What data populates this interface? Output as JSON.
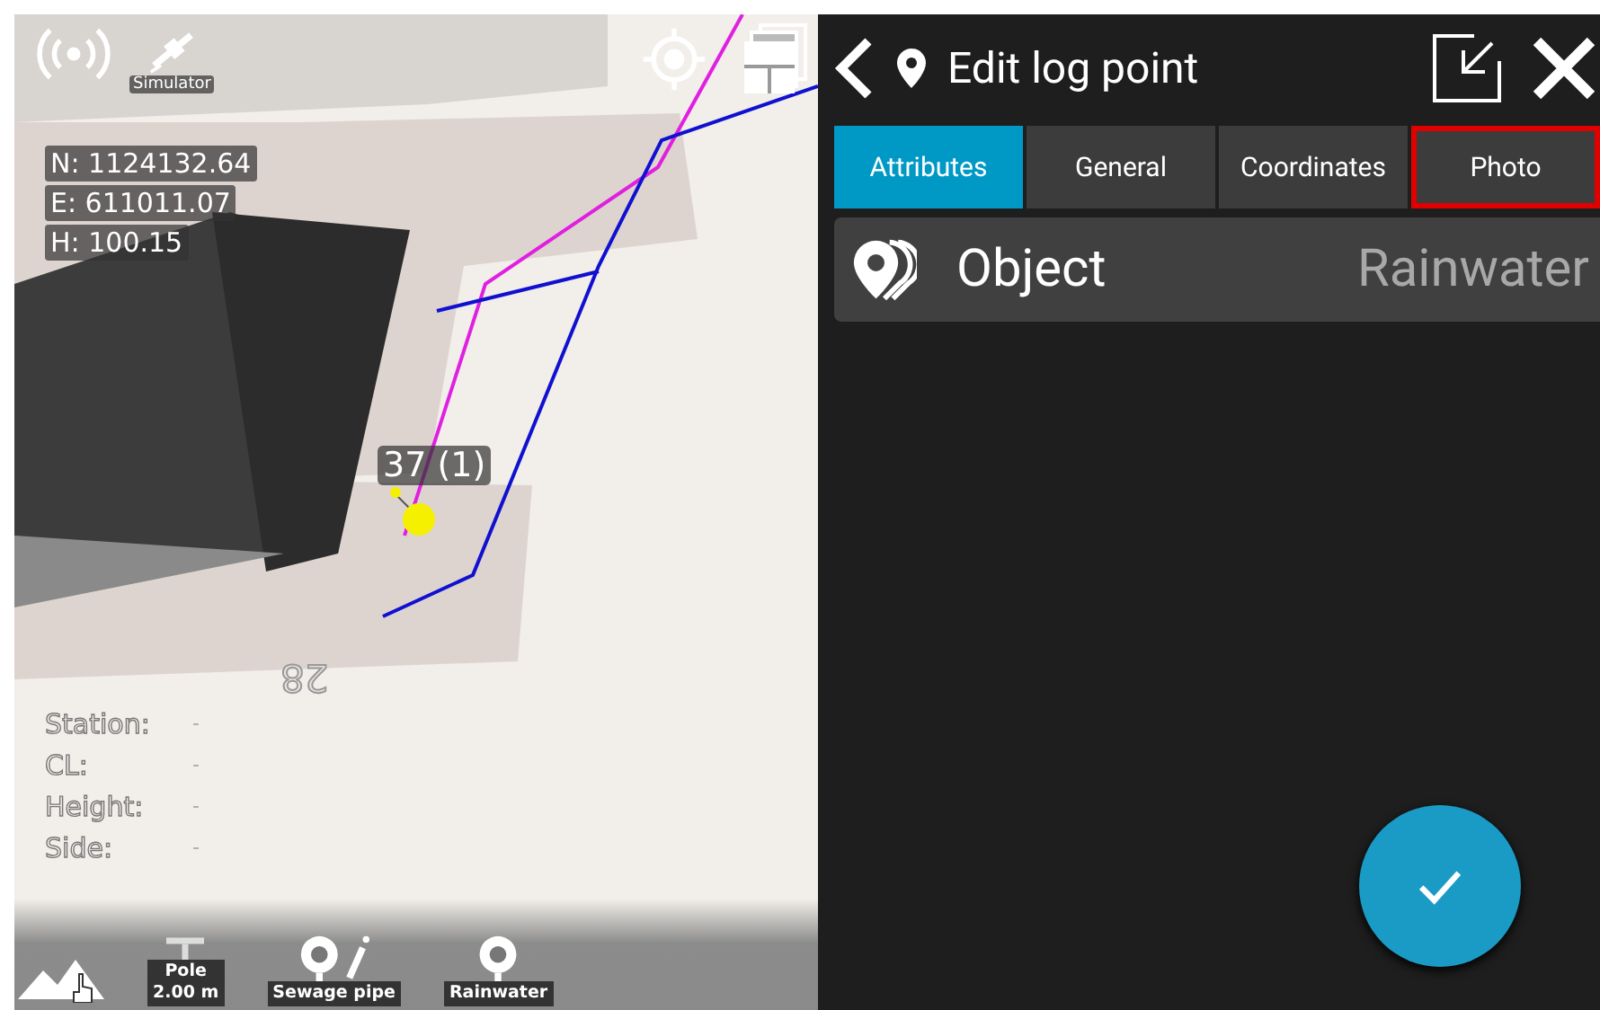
{
  "map": {
    "gps_label": "Simulator",
    "coordinates": [
      "N: 1124132.64",
      "E: 611011.07",
      "H: 100.15"
    ],
    "point_label": "37 (1)",
    "building_number": "28",
    "info": [
      {
        "label": "Station:",
        "value": "-"
      },
      {
        "label": "CL:",
        "value": "-"
      },
      {
        "label": "Height:",
        "value": "-"
      },
      {
        "label": "Side:",
        "value": "-"
      }
    ],
    "toolbar": [
      {
        "kind": "pole",
        "lines": [
          "Pole",
          "2.00 m"
        ]
      },
      {
        "kind": "pipe",
        "lines": [
          "Sewage pipe"
        ]
      },
      {
        "kind": "point",
        "lines": [
          "Rainwater"
        ]
      }
    ]
  },
  "panel": {
    "title": "Edit log point",
    "tabs": [
      {
        "label": "Attributes",
        "selected": true,
        "highlighted": false
      },
      {
        "label": "General",
        "selected": false,
        "highlighted": false
      },
      {
        "label": "Coordinates",
        "selected": false,
        "highlighted": false
      },
      {
        "label": "Photo",
        "selected": false,
        "highlighted": true
      }
    ],
    "attributes": [
      {
        "name": "Object",
        "value": "Rainwater"
      }
    ]
  }
}
